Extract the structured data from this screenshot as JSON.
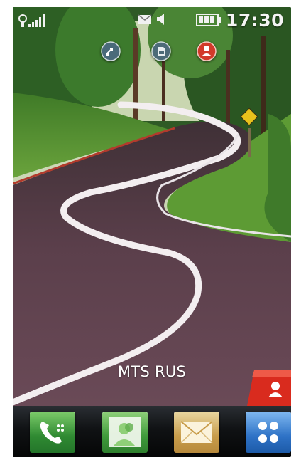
{
  "status_bar": {
    "time": "17:30",
    "icons": [
      "signal-strength-icon",
      "envelope-icon",
      "speaker-icon",
      "battery-icon"
    ]
  },
  "notifications": {
    "icons": [
      "connection-icon",
      "memory-card-icon",
      "missed-call-icon"
    ]
  },
  "home": {
    "carrier_name": "MTS RUS"
  },
  "dock": {
    "items": [
      "phone-icon",
      "contacts-icon",
      "messaging-icon",
      "main-menu-icon"
    ]
  },
  "colors": {
    "accent_red": "#d92b1e",
    "road": "#5a3a46",
    "grass": "#4c8a2a"
  }
}
